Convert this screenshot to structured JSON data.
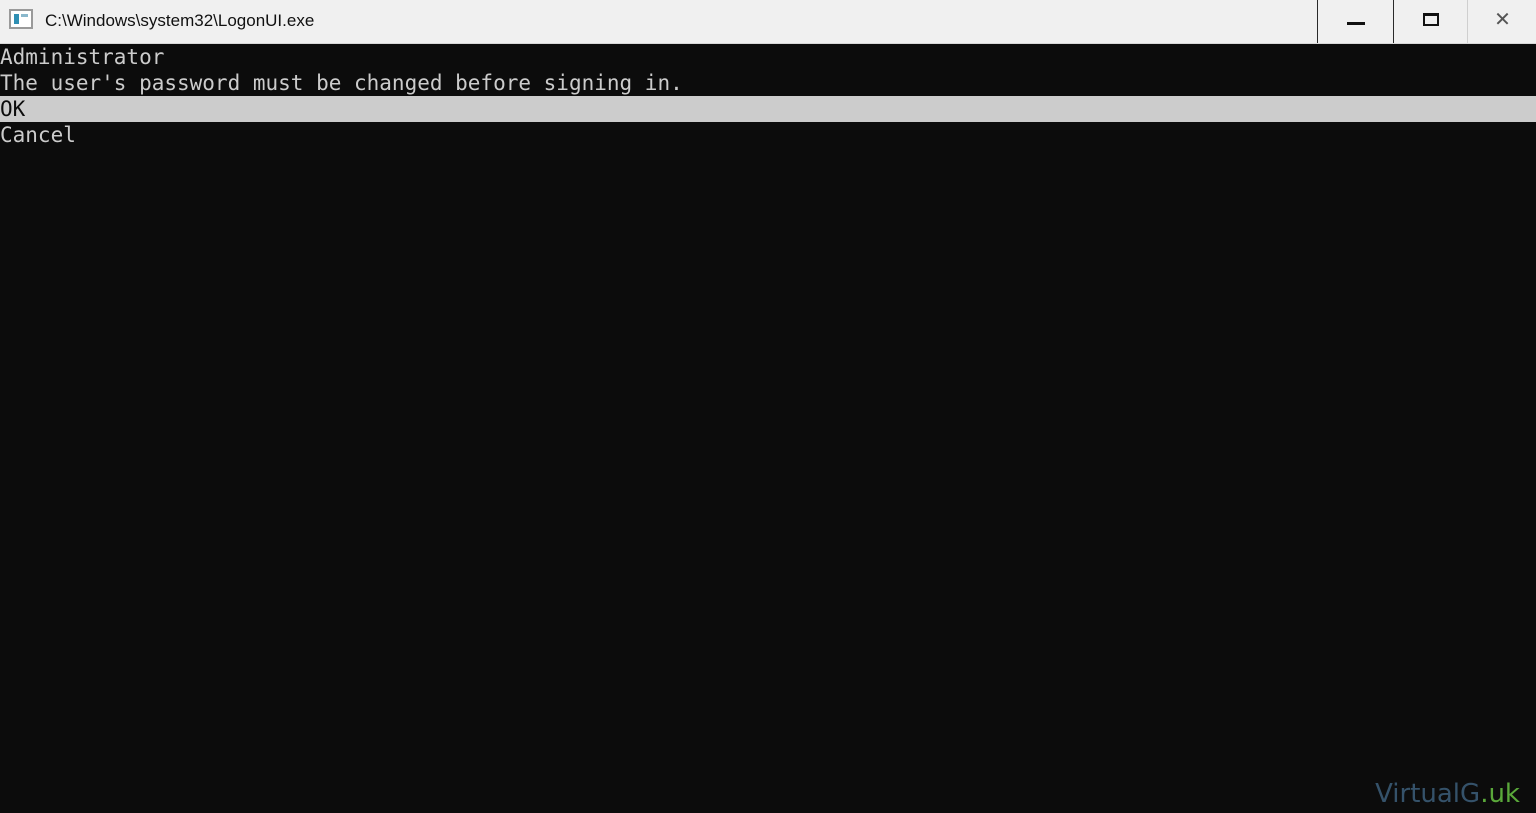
{
  "window": {
    "title": "C:\\Windows\\system32\\LogonUI.exe",
    "icon": "console-window-icon",
    "controls": {
      "minimize": "minimize-icon",
      "maximize": "maximize-icon",
      "close_glyph": "✕"
    }
  },
  "console": {
    "username": "Administrator",
    "message": "The user's password must be changed before signing in.",
    "options": [
      {
        "label": "OK",
        "selected": true
      },
      {
        "label": "Cancel",
        "selected": false
      }
    ]
  },
  "watermark": {
    "main": "VirtualG",
    "accent": ".uk"
  },
  "colors": {
    "console_background": "#0c0c0c",
    "console_text": "#cccccc",
    "selection_background": "#cccccc",
    "titlebar_background": "#f0f0f0",
    "watermark_main": "#35526a",
    "watermark_accent": "#5aa83a"
  }
}
